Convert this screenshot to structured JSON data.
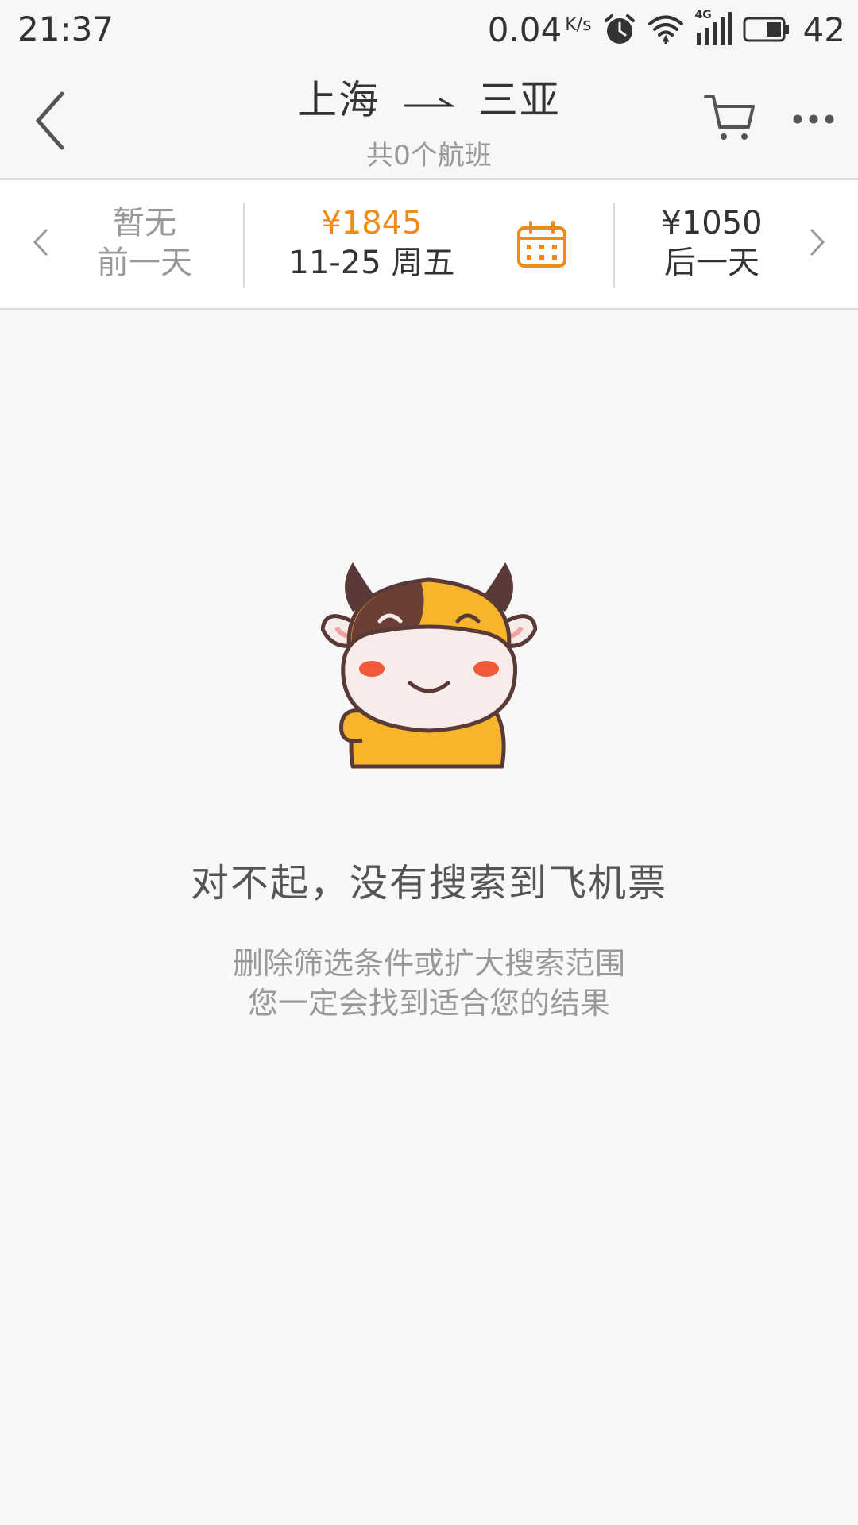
{
  "status_bar": {
    "time": "21:37",
    "net_speed": "0.04",
    "net_speed_unit": "K/s",
    "network_type": "4G",
    "battery_level": "42",
    "icons": [
      "alarm-icon",
      "wifi-icon",
      "signal-icon",
      "battery-icon"
    ]
  },
  "header": {
    "origin": "上海",
    "destination": "三亚",
    "subtitle": "共0个航班",
    "icons": [
      "back-arrow-icon",
      "cart-icon",
      "more-icon"
    ]
  },
  "date_bar": {
    "prev": {
      "price": "暂无",
      "label": "前一天"
    },
    "current": {
      "price": "¥1845",
      "date": "11-25 周五"
    },
    "next": {
      "price": "¥1050",
      "label": "后一天"
    },
    "icons": [
      "chevron-left-icon",
      "calendar-icon",
      "chevron-right-icon"
    ]
  },
  "empty_state": {
    "title": "对不起，没有搜索到飞机票",
    "desc_line1": "删除筛选条件或扩大搜索范围",
    "desc_line2": "您一定会找到适合您的结果"
  },
  "colors": {
    "accent": "#f28a16",
    "background": "#f8f8f8",
    "text_primary": "#333333",
    "text_secondary": "#999999",
    "mascot_yellow": "#f7b52c",
    "mascot_brown": "#5a3a36"
  }
}
